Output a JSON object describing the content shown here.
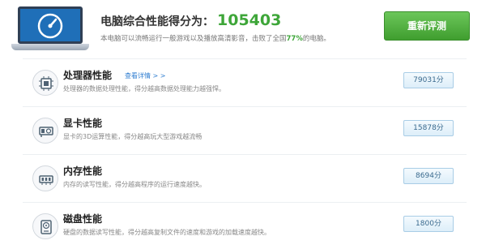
{
  "summary": {
    "title_label": "电脑综合性能得分为：",
    "score": "105403",
    "desc_prefix": "本电脑可以流畅运行一般游戏以及播放高清影音，击败了全国",
    "percent": "77%",
    "desc_suffix": "的电脑。"
  },
  "retest_button": "重新评测",
  "detail_link": "查看详情 > >",
  "rows": [
    {
      "title": "处理器性能",
      "desc": "处理器的数据处理性能，得分越高数据处理能力越强悍。",
      "score": "79031分",
      "icon": "cpu-icon"
    },
    {
      "title": "显卡性能",
      "desc": "显卡的3D运算性能，得分越高玩大型游戏越流畅",
      "score": "15878分",
      "icon": "graphics-card-icon"
    },
    {
      "title": "内存性能",
      "desc": "内存的读写性能，得分越高程序的运行速度越快。",
      "score": "8694分",
      "icon": "memory-icon"
    },
    {
      "title": "磁盘性能",
      "desc": "硬盘的数据读写性能，得分越高复制文件的速度和游戏的加载速度越快。",
      "score": "1800分",
      "icon": "disk-icon"
    }
  ],
  "colors": {
    "accent_green": "#3ea639",
    "link_blue": "#2f7dd0",
    "badge_text": "#3a6a8e"
  }
}
